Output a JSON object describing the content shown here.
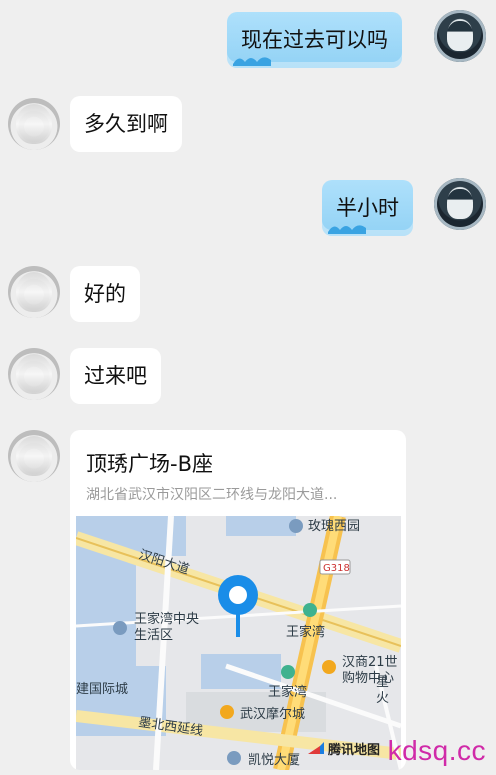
{
  "messages": [
    {
      "text": "现在过去可以吗"
    },
    {
      "text": "多久到啊"
    },
    {
      "text": "半小时"
    },
    {
      "text": "好的"
    },
    {
      "text": "过来吧"
    }
  ],
  "location_card": {
    "title": "顶琇广场-B座",
    "address": "湖北省武汉市汉阳区二环线与龙阳大道...",
    "map_labels": {
      "rose_garden": "玫瑰西园",
      "hanyang_ave": "汉阳大道",
      "g318": "G318",
      "wangjiawan_center": "王家湾中央",
      "wangjiawan_center_2": "生活区",
      "wangjiawan_1": "王家湾",
      "han_shang": "汉商21世",
      "han_shang_2": "购物中心",
      "wangjiawan_2": "王家湾",
      "jianguo": "建国际城",
      "wuhan_moer": "武汉摩尔城",
      "mobei": "墨北西延线",
      "kaiyue": "凯悦大厦",
      "xing": "星",
      "huo": "火",
      "brand": "腾讯地图"
    }
  },
  "watermark": "kdsq.cc",
  "colors": {
    "self_bubble": "#9fd8f7",
    "other_bubble": "#ffffff",
    "background": "#efefef",
    "pin": "#1a8de8",
    "watermark": "#d02aa8"
  }
}
